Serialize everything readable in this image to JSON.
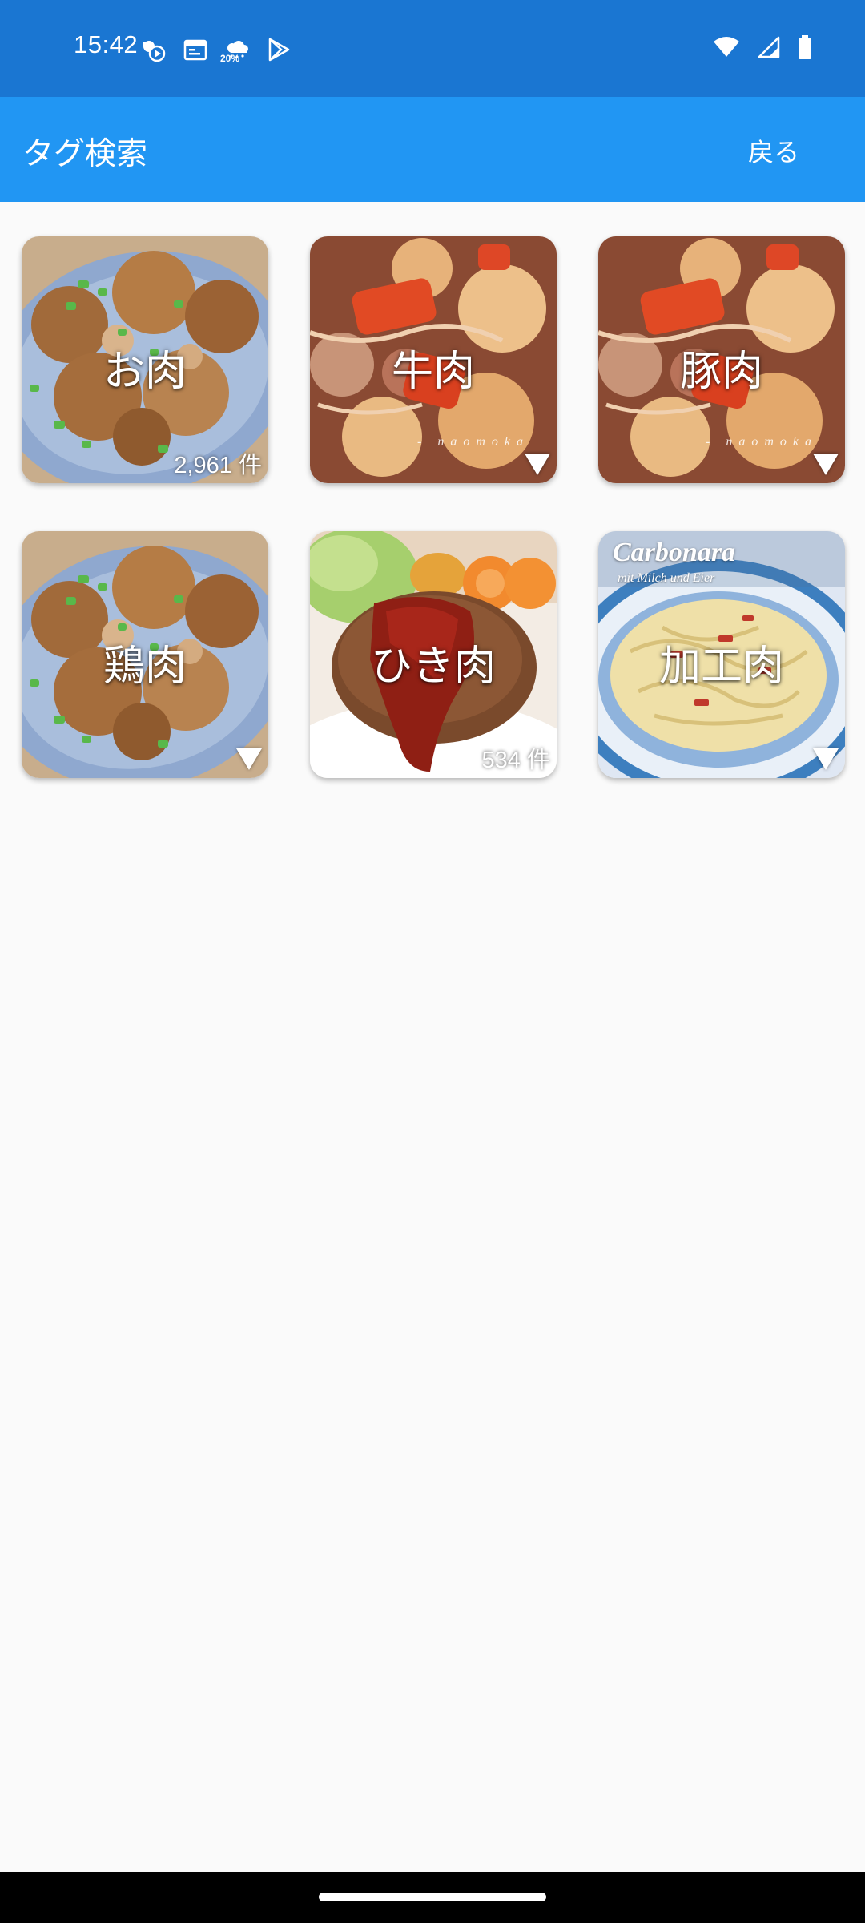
{
  "status_bar": {
    "time": "15:42",
    "weather_percent": "20%",
    "icons_left": [
      "weather-sync-icon",
      "calendar-icon",
      "weather-icon",
      "play-store-icon"
    ],
    "icons_right": [
      "wifi-icon",
      "signal-icon",
      "battery-icon"
    ]
  },
  "app_bar": {
    "title": "タグ検索",
    "back_label": "戻る"
  },
  "tags": [
    {
      "label": "お肉",
      "count": "2,961 件",
      "image": "chicken-dish"
    },
    {
      "label": "牛肉",
      "image": "nikujaga",
      "watermark": "- naomoka"
    },
    {
      "label": "豚肉",
      "image": "nikujaga",
      "watermark": "- naomoka"
    },
    {
      "label": "鶏肉",
      "image": "chicken-dish"
    },
    {
      "label": "ひき肉",
      "count": "534 件",
      "image": "hamburg-steak"
    },
    {
      "label": "加工肉",
      "image": "carbonara",
      "photo_title": "Carbonara",
      "photo_subtitle": "mit Milch und Eier"
    }
  ],
  "colors": {
    "status_bar": "#1a76d2",
    "app_bar": "#2196f3",
    "background": "#fafafa"
  }
}
